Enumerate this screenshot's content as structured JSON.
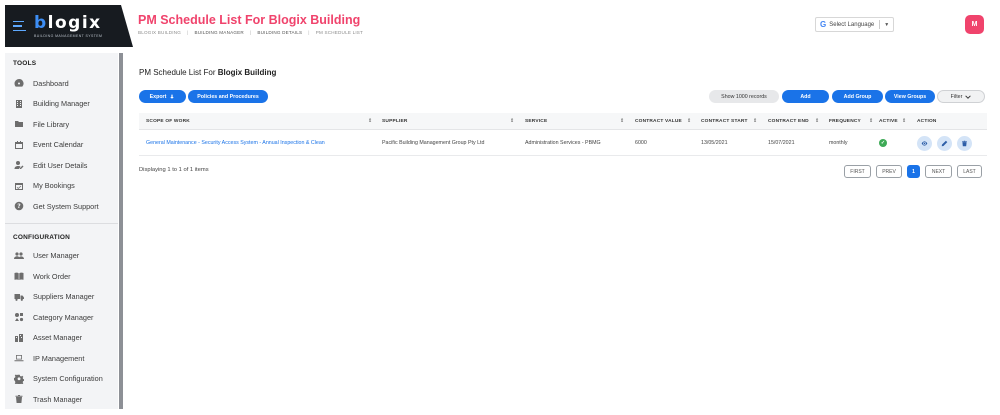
{
  "logo": {
    "word": "blogix",
    "word_first": "b",
    "word_rest": "logix",
    "subtitle": "BUILDING MANAGEMENT SYSTEM"
  },
  "header": {
    "title": "PM Schedule List For Blogix Building",
    "breadcrumb": [
      "BLOGIX BUILDING",
      "BUILDING MANAGER",
      "BUILDING DETAILS",
      "PM SCHEDULE LIST"
    ],
    "language": {
      "label": "Select Language",
      "google_letter": "G",
      "arrow": "▼"
    },
    "avatar_initial": "M"
  },
  "sidebar": {
    "tools_title": "TOOLS",
    "tools": [
      {
        "label": "Dashboard",
        "icon": "dashboard-icon"
      },
      {
        "label": "Building Manager",
        "icon": "building-icon"
      },
      {
        "label": "File Library",
        "icon": "folder-icon"
      },
      {
        "label": "Event Calendar",
        "icon": "calendar-icon"
      },
      {
        "label": "Edit User Details",
        "icon": "user-edit-icon"
      },
      {
        "label": "My Bookings",
        "icon": "calendar-check-icon"
      },
      {
        "label": "Get System Support",
        "icon": "question-icon"
      }
    ],
    "config_title": "CONFIGURATION",
    "config": [
      {
        "label": "User Manager",
        "icon": "users-icon"
      },
      {
        "label": "Work Order",
        "icon": "book-icon"
      },
      {
        "label": "Suppliers Manager",
        "icon": "truck-icon"
      },
      {
        "label": "Category Manager",
        "icon": "shapes-icon"
      },
      {
        "label": "Asset Manager",
        "icon": "assets-icon"
      },
      {
        "label": "IP Management",
        "icon": "laptop-icon"
      },
      {
        "label": "System Configuration",
        "icon": "cog-icon"
      },
      {
        "label": "Trash Manager",
        "icon": "trash-icon"
      }
    ]
  },
  "main": {
    "subtitle_prefix": "PM Schedule List For ",
    "subtitle_bold": "Blogix Building",
    "buttons": {
      "export": "Export",
      "policies": "Policies and Procedures",
      "show_records": "Show 1000 records",
      "add": "Add",
      "add_group": "Add Group",
      "view_groups": "View Groups",
      "filter": "Filter"
    },
    "columns": [
      "SCOPE OF WORK",
      "SUPPLIER",
      "SERVICE",
      "CONTRACT VALUE",
      "CONTRACT START",
      "CONTRACT END",
      "FREQUENCY",
      "ACTIVE",
      "ACTION"
    ],
    "rows": [
      {
        "scope": "General Maintenance - Security Access System - Annual Inspection & Clean",
        "supplier": "Pacific Building Management Group Pty Ltd",
        "service": "Administration Services - PBMG",
        "value": "6000",
        "start": "13/05/2021",
        "end": "15/07/2021",
        "frequency": "monthly",
        "active": true
      }
    ],
    "info": "Displaying 1 to 1 of 1 items",
    "pagination": {
      "first": "FIRST",
      "prev": "PREV",
      "page": "1",
      "next": "NEXT",
      "last": "LAST"
    }
  },
  "colors": {
    "accent": "#f0436c",
    "primary": "#1a73e8",
    "sidebar_bg": "#f3f4f6",
    "logo_bg": "#171b20",
    "success": "#3daa56"
  }
}
